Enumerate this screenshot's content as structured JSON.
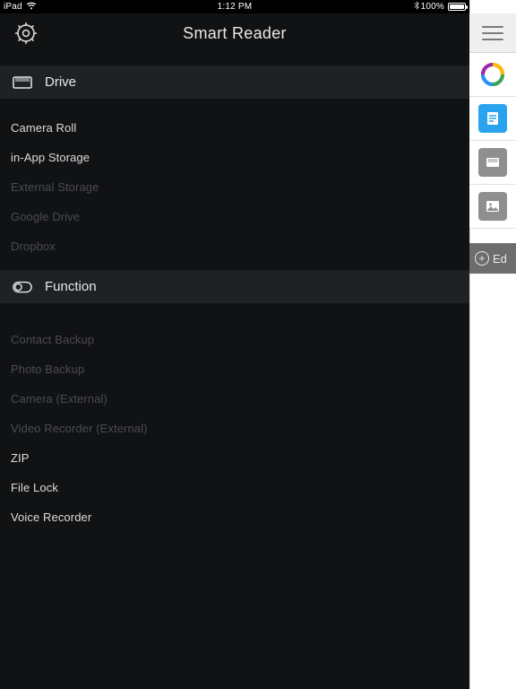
{
  "statusbar": {
    "device": "iPad",
    "time": "1:12 PM",
    "battery": "100%"
  },
  "header": {
    "title": "Smart Reader"
  },
  "sections": {
    "drive": {
      "label": "Drive",
      "items": [
        {
          "label": "Camera Roll",
          "enabled": true
        },
        {
          "label": "in-App Storage",
          "enabled": true
        },
        {
          "label": "External Storage",
          "enabled": false
        },
        {
          "label": "Google Drive",
          "enabled": false
        },
        {
          "label": "Dropbox",
          "enabled": false
        }
      ]
    },
    "function": {
      "label": "Function",
      "items": [
        {
          "label": "Contact Backup",
          "enabled": false
        },
        {
          "label": "Photo Backup",
          "enabled": false
        },
        {
          "label": "Camera (External)",
          "enabled": false
        },
        {
          "label": "Video Recorder (External)",
          "enabled": false
        },
        {
          "label": "ZIP",
          "enabled": true
        },
        {
          "label": "File Lock",
          "enabled": true
        },
        {
          "label": "Voice Recorder",
          "enabled": true
        }
      ]
    }
  },
  "rightbar": {
    "edit_label": "Ed"
  }
}
